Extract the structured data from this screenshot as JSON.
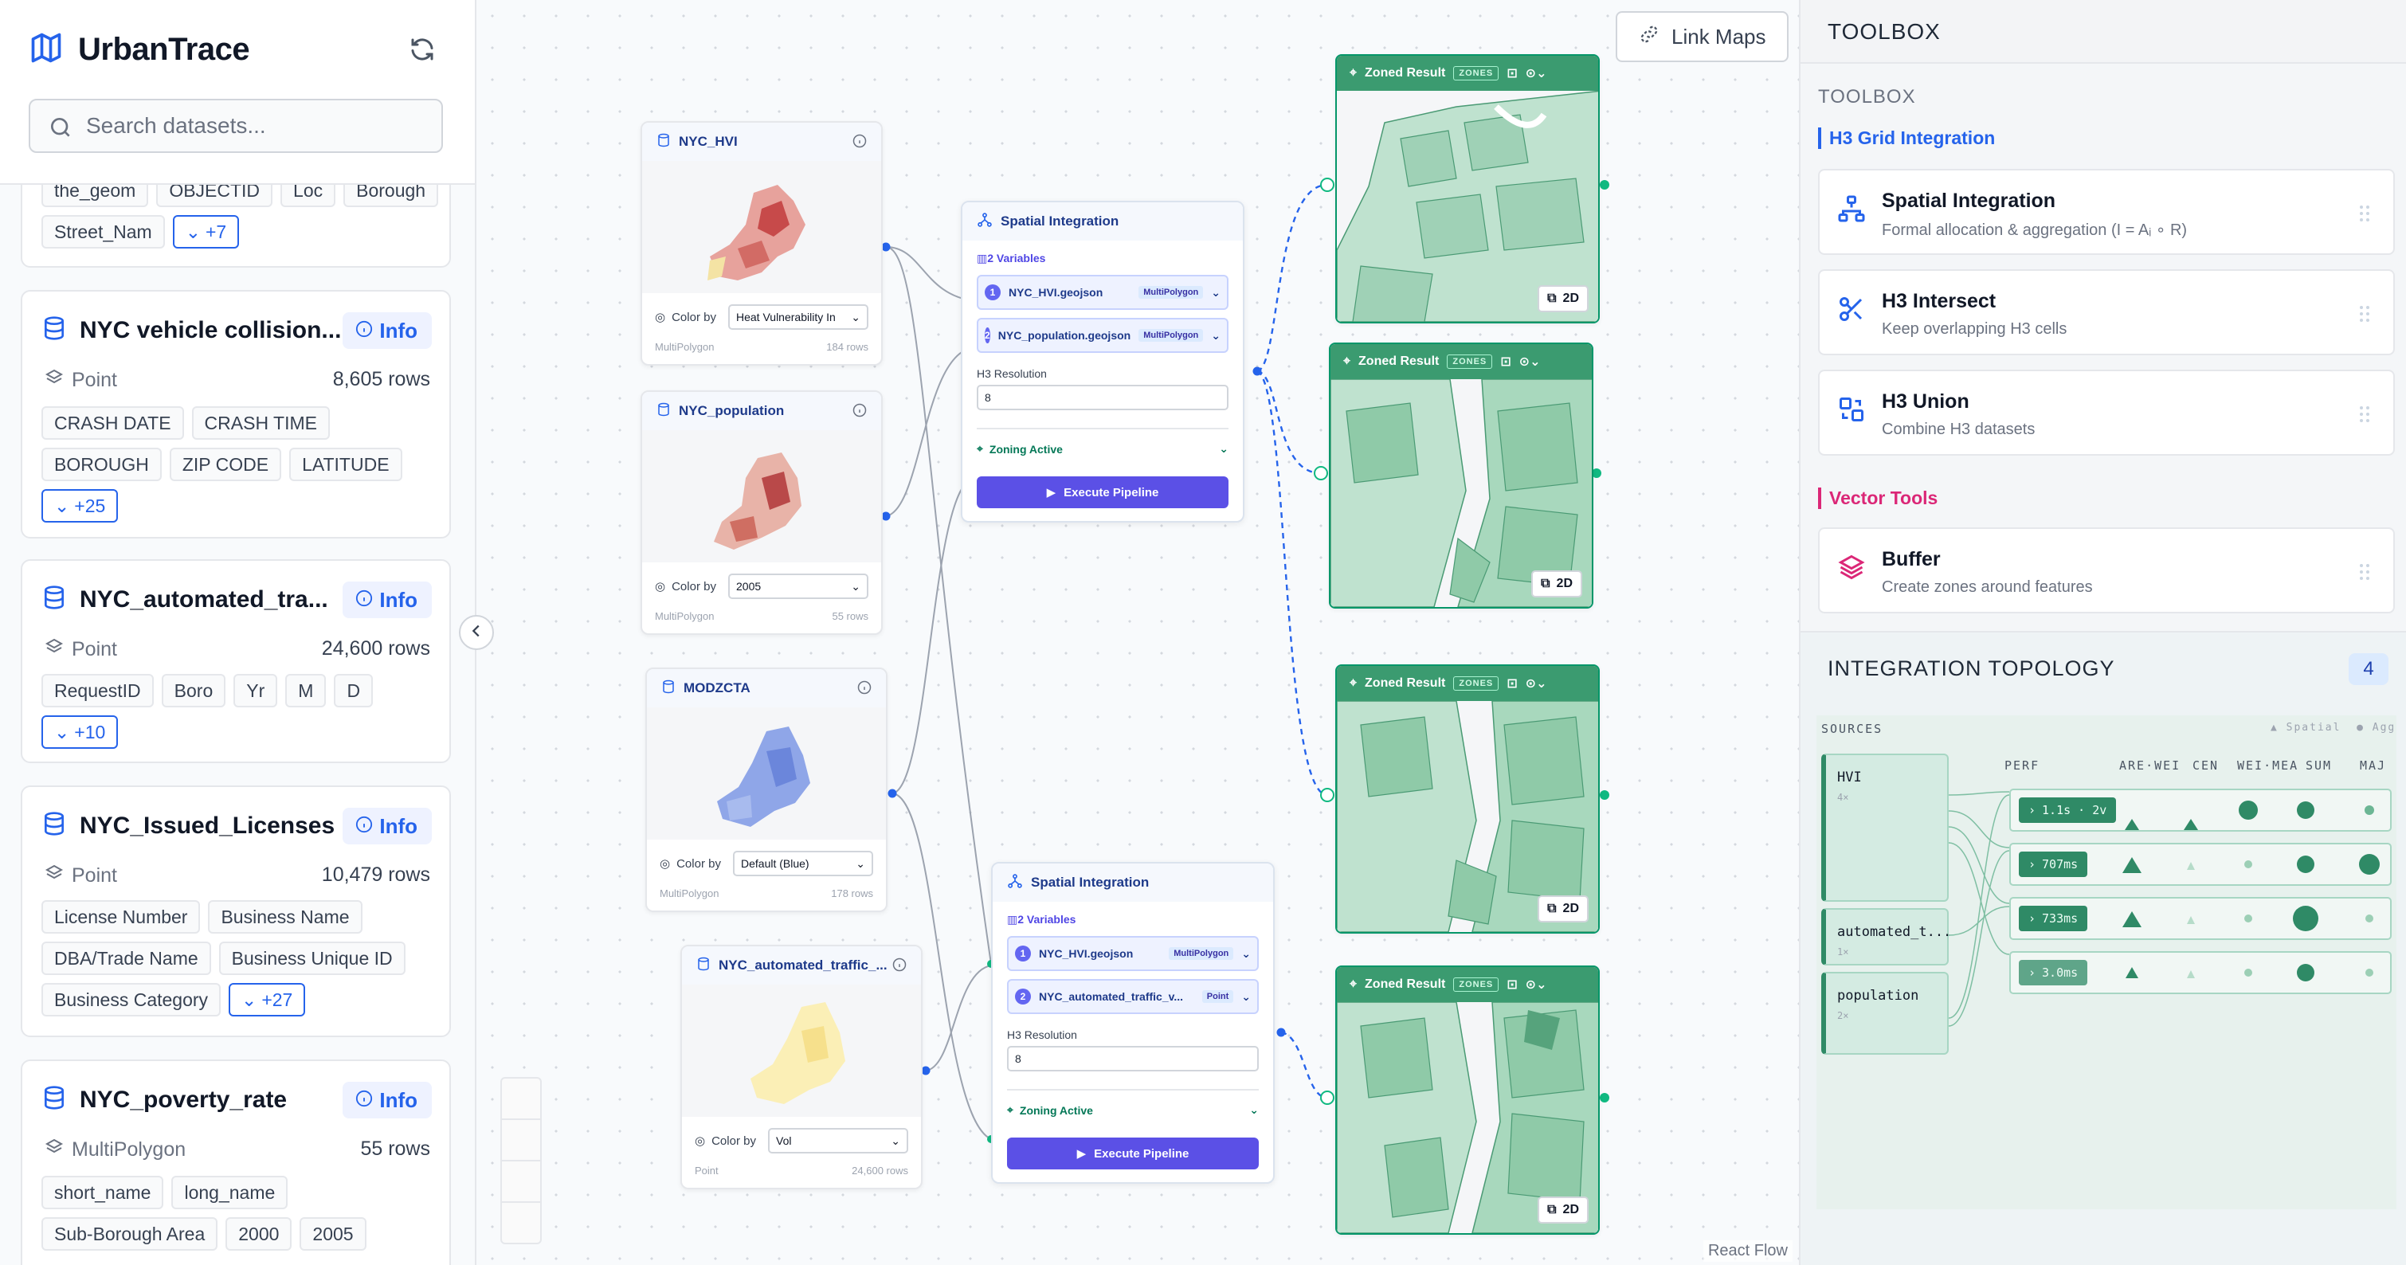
{
  "app": {
    "title": "UrbanTrace"
  },
  "search": {
    "placeholder": "Search datasets..."
  },
  "datasets": [
    {
      "name": "",
      "geom": "",
      "rows": "",
      "tags": [
        "the_geom",
        "OBJECTID",
        "Loc",
        "Borough",
        "Street_Nam"
      ],
      "more": "+7"
    },
    {
      "name": "NYC vehicle collision...",
      "geom": "Point",
      "rows": "8,605 rows",
      "tags": [
        "CRASH DATE",
        "CRASH TIME",
        "BOROUGH",
        "ZIP CODE",
        "LATITUDE"
      ],
      "more": "+25"
    },
    {
      "name": "NYC_automated_tra...",
      "geom": "Point",
      "rows": "24,600 rows",
      "tags": [
        "RequestID",
        "Boro",
        "Yr",
        "M",
        "D"
      ],
      "more": "+10"
    },
    {
      "name": "NYC_Issued_Licenses",
      "geom": "Point",
      "rows": "10,479 rows",
      "tags": [
        "License Number",
        "Business Name",
        "DBA/Trade Name",
        "Business Unique ID",
        "Business Category"
      ],
      "more": "+27"
    },
    {
      "name": "NYC_poverty_rate",
      "geom": "MultiPolygon",
      "rows": "55 rows",
      "tags": [
        "short_name",
        "long_name",
        "Sub-Borough Area",
        "2000",
        "2005"
      ],
      "more": ""
    }
  ],
  "info_label": "Info",
  "canvas": {
    "link_maps": "Link Maps",
    "react_flow": "React Flow",
    "color_by_label": "Color by",
    "sources": [
      {
        "title": "NYC_HVI",
        "color_by": "Heat Vulnerability In",
        "geom": "MultiPolygon",
        "rows": "184 rows"
      },
      {
        "title": "NYC_population",
        "color_by": "2005",
        "geom": "MultiPolygon",
        "rows": "55 rows"
      },
      {
        "title": "MODZCTA",
        "color_by": "Default (Blue)",
        "geom": "MultiPolygon",
        "rows": "178 rows"
      },
      {
        "title": "NYC_automated_traffic_...",
        "color_by": "Vol",
        "geom": "Point",
        "rows": "24,600 rows"
      }
    ],
    "integrations": [
      {
        "title": "Spatial Integration",
        "vars": "2 Variables",
        "var1": "NYC_HVI.geojson",
        "var1_geom": "MultiPolygon",
        "var2": "NYC_population.geojson",
        "var2_geom": "MultiPolygon",
        "res_label": "H3 Resolution",
        "res": "8",
        "zoning": "Zoning Active",
        "exec": "Execute Pipeline"
      },
      {
        "title": "Spatial Integration",
        "vars": "2 Variables",
        "var1": "NYC_HVI.geojson",
        "var1_geom": "MultiPolygon",
        "var2": "NYC_automated_traffic_v...",
        "var2_geom": "Point",
        "res_label": "H3 Resolution",
        "res": "8",
        "zoning": "Zoning Active",
        "exec": "Execute Pipeline"
      }
    ],
    "results": [
      {
        "title": "Zoned Result",
        "badge": "ZONES",
        "mode": "2D"
      },
      {
        "title": "Zoned Result",
        "badge": "ZONES",
        "mode": "2D"
      },
      {
        "title": "Zoned Result",
        "badge": "ZONES",
        "mode": "2D"
      },
      {
        "title": "Zoned Result",
        "badge": "ZONES",
        "mode": "2D"
      }
    ]
  },
  "toolbox": {
    "title": "TOOLBOX",
    "subtitle": "TOOLBOX",
    "section_h3": "H3 Grid Integration",
    "section_vector": "Vector Tools",
    "tools": [
      {
        "name": "Spatial Integration",
        "desc": "Formal allocation & aggregation (I = Aᵢ ∘ R)"
      },
      {
        "name": "H3 Intersect",
        "desc": "Keep overlapping H3 cells"
      },
      {
        "name": "H3 Union",
        "desc": "Combine H3 datasets"
      },
      {
        "name": "Buffer",
        "desc": "Create zones around features"
      }
    ],
    "colors": {
      "h3": "#2563eb",
      "vector": "#db2777"
    }
  },
  "topology": {
    "title": "INTEGRATION TOPOLOGY",
    "count": "4",
    "sources_label": "SOURCES",
    "legend_spatial": "Spatial",
    "legend_agg": "Agg",
    "columns": [
      "PERF",
      "ARE·WEI",
      "CEN",
      "WEI·MEA",
      "SUM",
      "MAJ"
    ],
    "sources": [
      {
        "name": "HVI",
        "count": "4×"
      },
      {
        "name": "automated_t...",
        "count": "1×"
      },
      {
        "name": "population",
        "count": "2×"
      }
    ],
    "rows": [
      {
        "perf": "1.1s · 2v"
      },
      {
        "perf": "707ms"
      },
      {
        "perf": "733ms"
      },
      {
        "perf": "3.0ms"
      }
    ]
  }
}
